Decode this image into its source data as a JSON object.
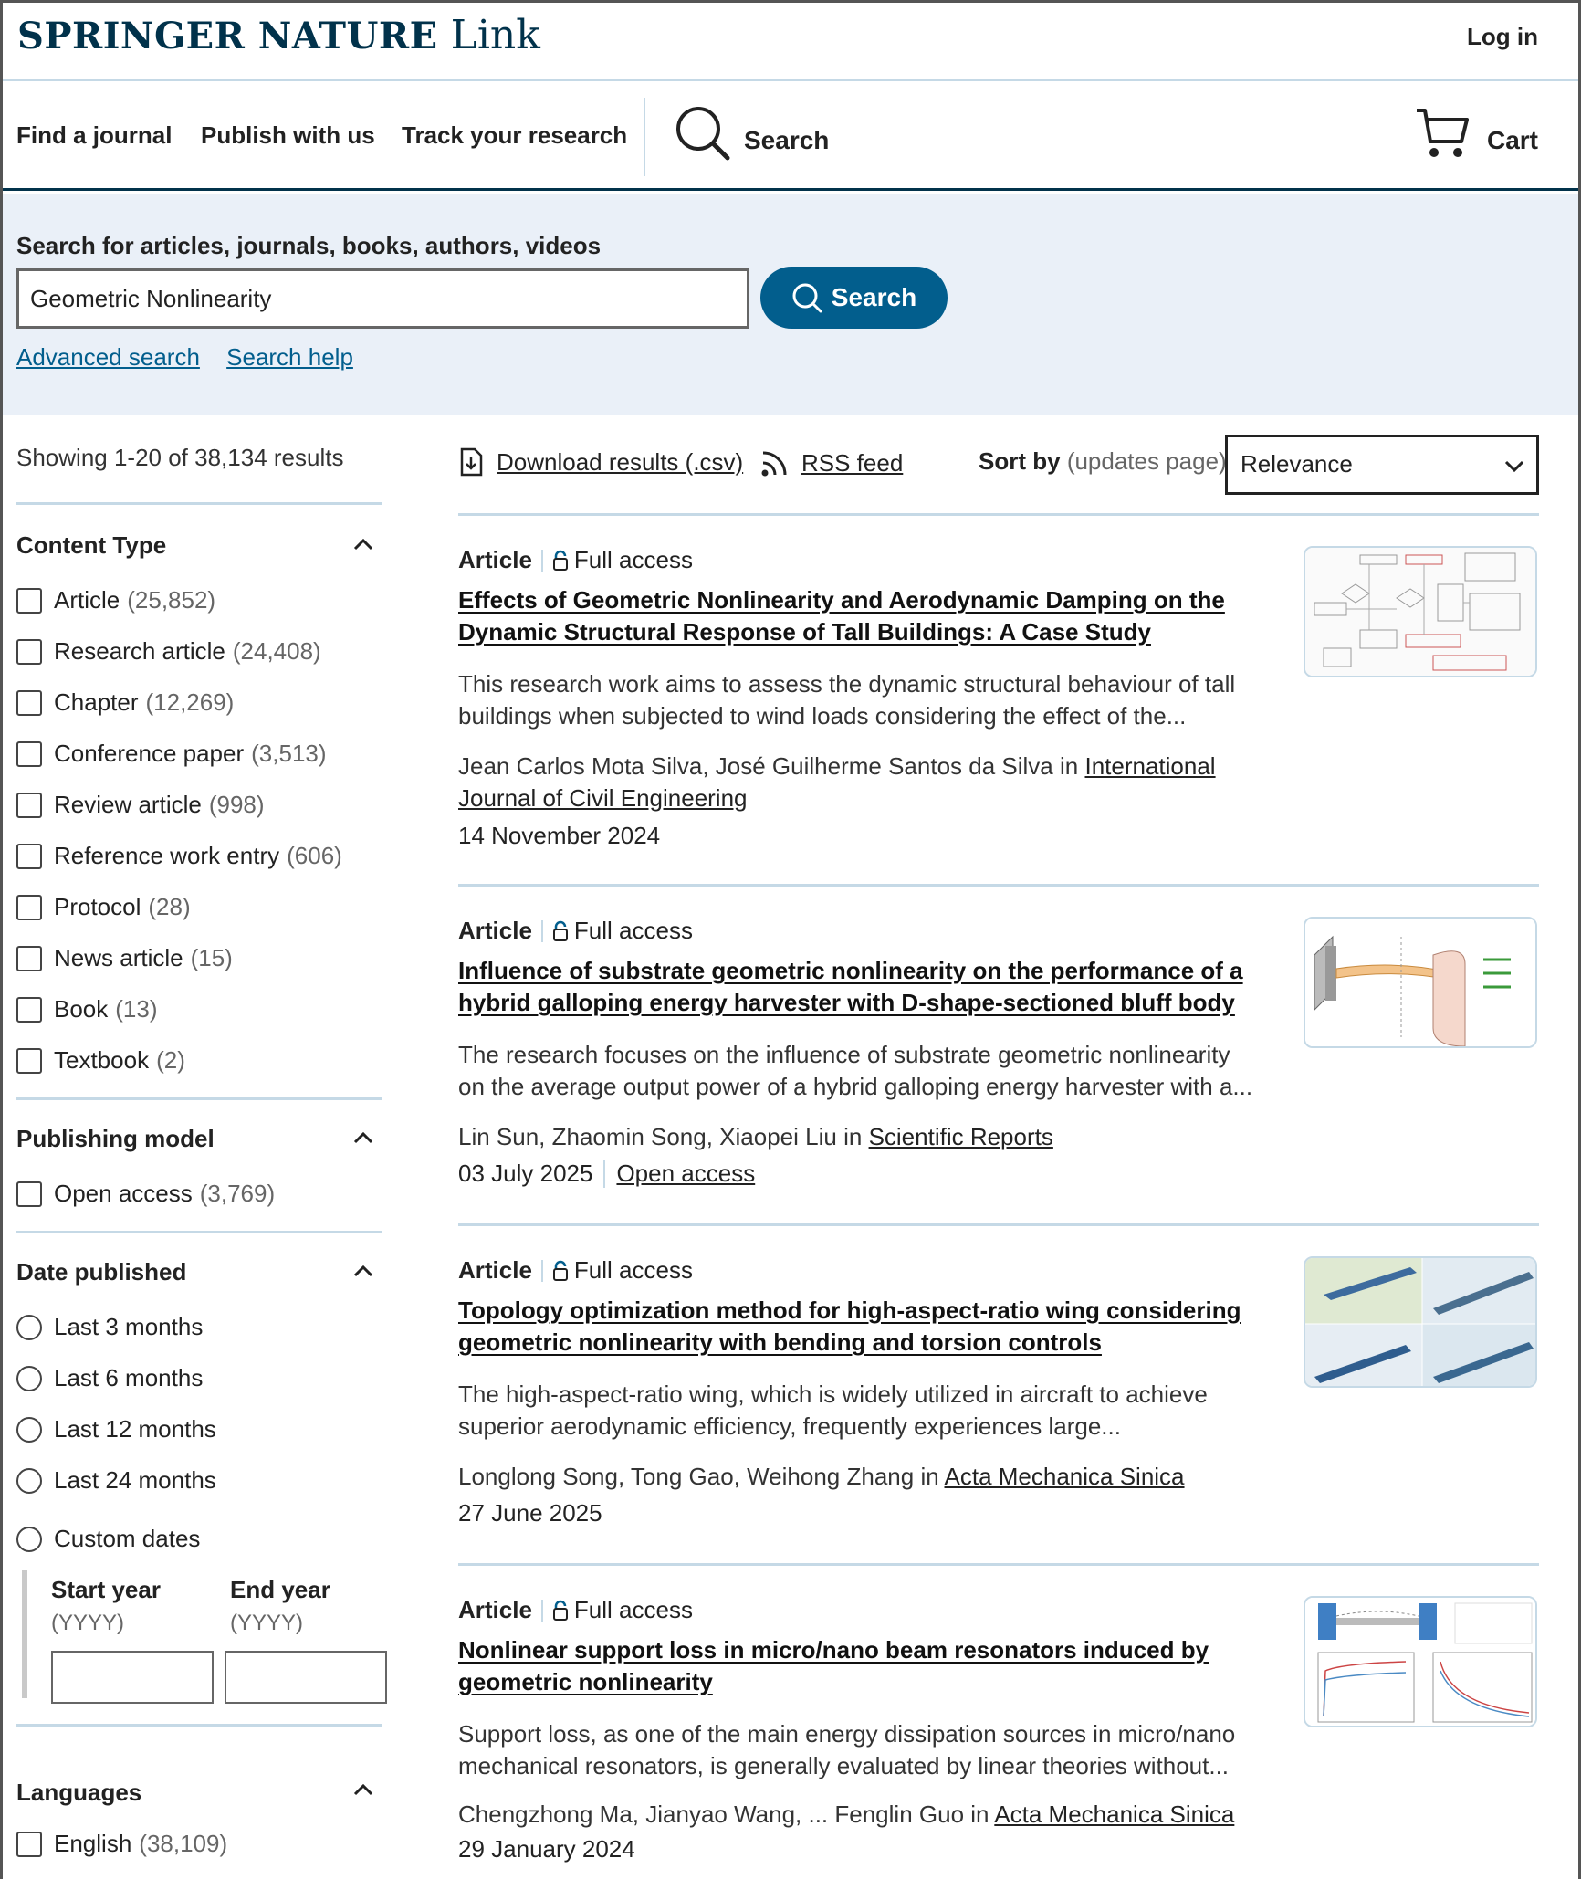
{
  "header": {
    "logo_brand": "SPRINGER NATURE",
    "logo_product": "Link",
    "login_label": "Log in"
  },
  "nav": {
    "items": [
      "Find a journal",
      "Publish with us",
      "Track your research"
    ],
    "search_label": "Search",
    "cart_label": "Cart"
  },
  "search": {
    "label": "Search for articles, journals, books, authors, videos",
    "query": "Geometric Nonlinearity",
    "button_label": "Search",
    "advanced_label": "Advanced search",
    "help_label": "Search help"
  },
  "sidebar": {
    "showing": "Showing 1-20 of 38,134 results",
    "content_type": {
      "title": "Content Type",
      "options": [
        {
          "label": "Article",
          "count": "(25,852)"
        },
        {
          "label": "Research article",
          "count": "(24,408)"
        },
        {
          "label": "Chapter",
          "count": "(12,269)"
        },
        {
          "label": "Conference paper",
          "count": "(3,513)"
        },
        {
          "label": "Review article",
          "count": "(998)"
        },
        {
          "label": "Reference work entry",
          "count": "(606)"
        },
        {
          "label": "Protocol",
          "count": "(28)"
        },
        {
          "label": "News article",
          "count": "(15)"
        },
        {
          "label": "Book",
          "count": "(13)"
        },
        {
          "label": "Textbook",
          "count": "(2)"
        }
      ]
    },
    "publishing_model": {
      "title": "Publishing model",
      "options": [
        {
          "label": "Open access",
          "count": "(3,769)"
        }
      ]
    },
    "date_published": {
      "title": "Date published",
      "options": [
        "Last 3 months",
        "Last 6 months",
        "Last 12 months",
        "Last 24 months",
        "Custom dates"
      ],
      "start_label": "Start year",
      "start_hint": "(YYYY)",
      "end_label": "End year",
      "end_hint": "(YYYY)"
    },
    "languages": {
      "title": "Languages",
      "options": [
        {
          "label": "English",
          "count": "(38,109)"
        }
      ]
    }
  },
  "toolbar": {
    "download_label": "Download results (.csv)",
    "rss_label": "RSS feed",
    "sort_label": "Sort by",
    "sort_hint": "(updates page)",
    "sort_value": "Relevance"
  },
  "results": [
    {
      "type": "Article",
      "access": "Full access",
      "title": "Effects of Geometric Nonlinearity and Aerodynamic Damping on the Dynamic Structural Response of Tall Buildings: A Case Study",
      "snippet": "This research work aims to assess the dynamic structural behaviour of tall buildings when subjected to wind loads considering the effect of the...",
      "authors": "Jean Carlos Mota Silva, José Guilherme Santos da Silva",
      "in": "in",
      "journal": "International Journal of Civil Engineering",
      "date": "14 November 2024",
      "open_access": ""
    },
    {
      "type": "Article",
      "access": "Full access",
      "title": "Influence of substrate geometric nonlinearity on the performance of a hybrid galloping energy harvester with D-shape-sectioned bluff body",
      "snippet": "The research focuses on the influence of substrate geometric nonlinearity on the average output power of a hybrid galloping energy harvester with a...",
      "authors": "Lin Sun, Zhaomin Song, Xiaopei Liu",
      "in": "in",
      "journal": "Scientific Reports",
      "date": "03 July 2025",
      "open_access": "Open access"
    },
    {
      "type": "Article",
      "access": "Full access",
      "title": "Topology optimization method for high-aspect-ratio wing considering geometric nonlinearity with bending and torsion controls",
      "snippet": "The high-aspect-ratio wing, which is widely utilized in aircraft to achieve superior aerodynamic efficiency, frequently experiences large...",
      "authors": "Longlong Song, Tong Gao, Weihong Zhang",
      "in": "in",
      "journal": "Acta Mechanica Sinica",
      "date": "27 June 2025",
      "open_access": ""
    },
    {
      "type": "Article",
      "access": "Full access",
      "title": "Nonlinear support loss in micro/nano beam resonators induced by geometric nonlinearity",
      "snippet": "Support loss, as one of the main energy dissipation sources in micro/nano mechanical resonators, is generally evaluated by linear theories without...",
      "authors": "Chengzhong Ma, Jianyao Wang, ... Fenglin Guo",
      "in": "in",
      "journal": "Acta Mechanica Sinica",
      "date": "29 January 2024",
      "open_access": ""
    }
  ]
}
